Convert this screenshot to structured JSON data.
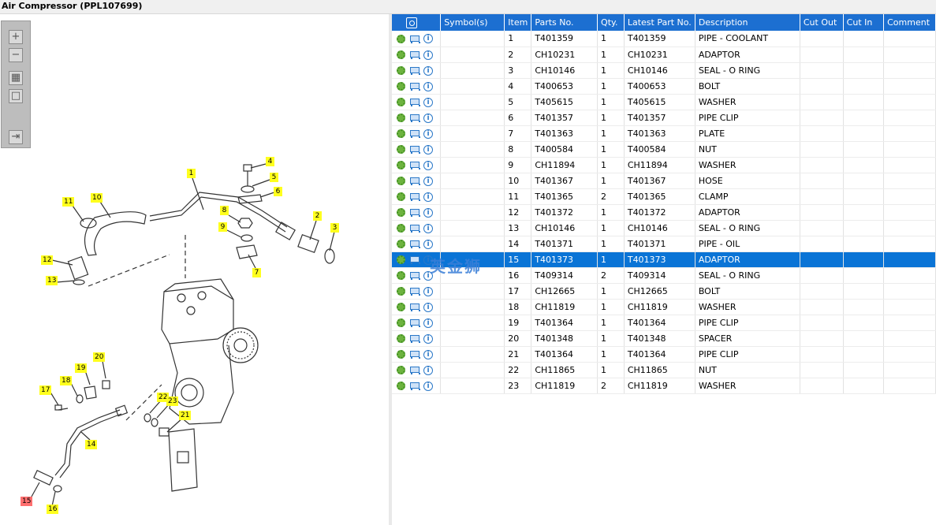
{
  "window": {
    "title": "Air Compressor (PPL107699)"
  },
  "toolbar": {
    "buttons": [
      {
        "icon": "zoom-in-icon"
      },
      {
        "icon": "zoom-out-icon"
      },
      {
        "icon": "fit-page-icon"
      },
      {
        "icon": "actual-size-icon"
      },
      {
        "icon": "toggle-panel-icon"
      }
    ]
  },
  "diagram": {
    "callouts": [
      "1",
      "2",
      "3",
      "4",
      "5",
      "6",
      "7",
      "8",
      "9",
      "10",
      "11",
      "12",
      "13",
      "14",
      "15",
      "16",
      "17",
      "18",
      "19",
      "20",
      "21",
      "22",
      "23"
    ],
    "selected_callout": "15"
  },
  "table": {
    "headers": {
      "icons": "",
      "symbols": "Symbol(s)",
      "item": "Item",
      "parts_no": "Parts No.",
      "qty": "Qty.",
      "latest_part_no": "Latest Part No.",
      "description": "Description",
      "cut_out": "Cut Out",
      "cut_in": "Cut In",
      "comment": "Comment"
    },
    "rows": [
      {
        "item": "1",
        "parts_no": "T401359",
        "qty": "1",
        "latest": "T401359",
        "desc": "PIPE - COOLANT"
      },
      {
        "item": "2",
        "parts_no": "CH10231",
        "qty": "1",
        "latest": "CH10231",
        "desc": "ADAPTOR"
      },
      {
        "item": "3",
        "parts_no": "CH10146",
        "qty": "1",
        "latest": "CH10146",
        "desc": "SEAL - O RING"
      },
      {
        "item": "4",
        "parts_no": "T400653",
        "qty": "1",
        "latest": "T400653",
        "desc": "BOLT"
      },
      {
        "item": "5",
        "parts_no": "T405615",
        "qty": "1",
        "latest": "T405615",
        "desc": "WASHER"
      },
      {
        "item": "6",
        "parts_no": "T401357",
        "qty": "1",
        "latest": "T401357",
        "desc": "PIPE CLIP"
      },
      {
        "item": "7",
        "parts_no": "T401363",
        "qty": "1",
        "latest": "T401363",
        "desc": "PLATE"
      },
      {
        "item": "8",
        "parts_no": "T400584",
        "qty": "1",
        "latest": "T400584",
        "desc": "NUT"
      },
      {
        "item": "9",
        "parts_no": "CH11894",
        "qty": "1",
        "latest": "CH11894",
        "desc": "WASHER"
      },
      {
        "item": "10",
        "parts_no": "T401367",
        "qty": "1",
        "latest": "T401367",
        "desc": "HOSE"
      },
      {
        "item": "11",
        "parts_no": "T401365",
        "qty": "2",
        "latest": "T401365",
        "desc": "CLAMP"
      },
      {
        "item": "12",
        "parts_no": "T401372",
        "qty": "1",
        "latest": "T401372",
        "desc": "ADAPTOR"
      },
      {
        "item": "13",
        "parts_no": "CH10146",
        "qty": "1",
        "latest": "CH10146",
        "desc": "SEAL - O RING"
      },
      {
        "item": "14",
        "parts_no": "T401371",
        "qty": "1",
        "latest": "T401371",
        "desc": "PIPE - OIL"
      },
      {
        "item": "15",
        "parts_no": "T401373",
        "qty": "1",
        "latest": "T401373",
        "desc": "ADAPTOR",
        "selected": true
      },
      {
        "item": "16",
        "parts_no": "T409314",
        "qty": "2",
        "latest": "T409314",
        "desc": "SEAL - O RING"
      },
      {
        "item": "17",
        "parts_no": "CH12665",
        "qty": "1",
        "latest": "CH12665",
        "desc": "BOLT"
      },
      {
        "item": "18",
        "parts_no": "CH11819",
        "qty": "1",
        "latest": "CH11819",
        "desc": "WASHER"
      },
      {
        "item": "19",
        "parts_no": "T401364",
        "qty": "1",
        "latest": "T401364",
        "desc": "PIPE CLIP"
      },
      {
        "item": "20",
        "parts_no": "T401348",
        "qty": "1",
        "latest": "T401348",
        "desc": "SPACER"
      },
      {
        "item": "21",
        "parts_no": "T401364",
        "qty": "1",
        "latest": "T401364",
        "desc": "PIPE CLIP"
      },
      {
        "item": "22",
        "parts_no": "CH11865",
        "qty": "1",
        "latest": "CH11865",
        "desc": "NUT"
      },
      {
        "item": "23",
        "parts_no": "CH11819",
        "qty": "2",
        "latest": "CH11819",
        "desc": "WASHER"
      }
    ]
  },
  "watermark": {
    "text": "英金狮"
  },
  "colors": {
    "header_bg": "#1c6fd1",
    "selected_row": "#0a74d6",
    "callout": "#ffff1e",
    "callout_selected": "#ff6f6f"
  }
}
